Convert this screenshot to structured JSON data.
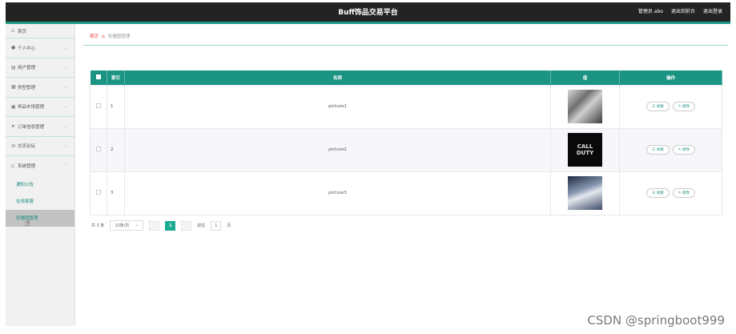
{
  "header": {
    "title": "Buff饰品交易平台",
    "admin": "管理员 abo",
    "back": "退出到前台",
    "logout": "退出登录"
  },
  "sidebar": {
    "items": [
      {
        "label": "首页",
        "icon": "home-icon"
      },
      {
        "label": "个人中心",
        "icon": "user-icon"
      },
      {
        "label": "用户管理",
        "icon": "users-icon"
      },
      {
        "label": "类型管理",
        "icon": "grid-icon"
      },
      {
        "label": "饰品市场管理",
        "icon": "tag-icon"
      },
      {
        "label": "订单信息管理",
        "icon": "send-icon"
      },
      {
        "label": "交流论坛",
        "icon": "mail-icon"
      },
      {
        "label": "系统管理",
        "icon": "system-icon"
      }
    ],
    "sub_items": [
      {
        "label": "通知公告"
      },
      {
        "label": "在线客服"
      },
      {
        "label": "轮播图管理"
      }
    ]
  },
  "breadcrumb": {
    "home": "首页",
    "current": "轮播图管理"
  },
  "table": {
    "headers": [
      "索引",
      "名称",
      "值",
      "操作"
    ],
    "rows": [
      {
        "index": "1",
        "name": "picture1",
        "image": "pic1"
      },
      {
        "index": "2",
        "name": "picture2",
        "image": "pic2",
        "image_text": "CALL DUTY"
      },
      {
        "index": "3",
        "name": "picture3",
        "image": "pic3"
      }
    ],
    "detail_label": "详情",
    "edit_label": "修改"
  },
  "pagination": {
    "total": "共 3 条",
    "page_size": "10条/页",
    "current": "1",
    "goto": "前往",
    "goto_value": "1",
    "page_unit": "页"
  },
  "watermark": "CSDN @springboot999",
  "colors": {
    "accent": "#1b9483",
    "topbar": "#232323",
    "breadcrumb_home": "#e2423b"
  }
}
